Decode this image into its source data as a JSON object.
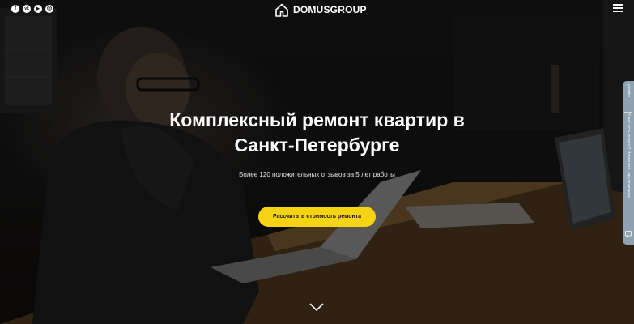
{
  "header": {
    "social_icons": [
      {
        "name": "facebook-icon",
        "glyph": "f"
      },
      {
        "name": "vk-icon",
        "glyph": "vk"
      },
      {
        "name": "youtube-icon",
        "glyph": "▶"
      },
      {
        "name": "instagram-icon",
        "glyph": "◎"
      }
    ],
    "logo_text": "DOMUSGROUP",
    "menu_icon": "hamburger-menu-icon"
  },
  "hero": {
    "title_line1": "Комплексный ремонт квартир в",
    "title_line2": "Санкт-Петербурге",
    "subtitle": "Более 120 положительных отзывов за 5 лет работы",
    "cta_label": "Рассчитать стоимость ремонта",
    "scroll_icon": "chevron-down-icon"
  },
  "side_widget": {
    "label_top": "yandex",
    "label_main": "У вас есть вопрос? Напишите - мы поможем",
    "icon": "chat-icon"
  },
  "colors": {
    "accent": "#f6d313",
    "widget_bg": "#8ea2b1",
    "background": "#0b0b0b"
  }
}
